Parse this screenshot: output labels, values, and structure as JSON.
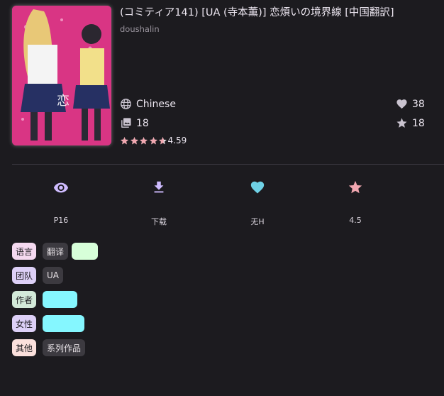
{
  "gallery": {
    "title": "(コミティア141) [UA (寺本薫)] 恋煩いの境界線 [中国翻訳]",
    "uploader": "doushalin",
    "language": "Chinese",
    "pages": "18",
    "favorites": "38",
    "stars": "18",
    "rating": "4.59",
    "rating_value": 4.59
  },
  "actions": [
    {
      "label": "P16",
      "icon": "eye-icon"
    },
    {
      "label": "下载",
      "icon": "download-icon"
    },
    {
      "label": "无H",
      "icon": "heart-icon"
    },
    {
      "label": "4.5",
      "icon": "star-icon"
    }
  ],
  "tags": {
    "language": {
      "ns": "语言",
      "values": [
        "翻译"
      ]
    },
    "group": {
      "ns": "团队",
      "values": [
        "UA"
      ]
    },
    "artist": {
      "ns": "作者"
    },
    "female": {
      "ns": "女性"
    },
    "other": {
      "ns": "其他",
      "values": [
        "系列作品"
      ]
    }
  },
  "colors": {
    "background": "#1c1b1f",
    "accent": "#cfbcff",
    "heart": "#6fd2e6",
    "star": "#f1a7b0",
    "tag_highlight_green": "#d7ffd9",
    "tag_highlight_cyan": "#85f7ff"
  }
}
